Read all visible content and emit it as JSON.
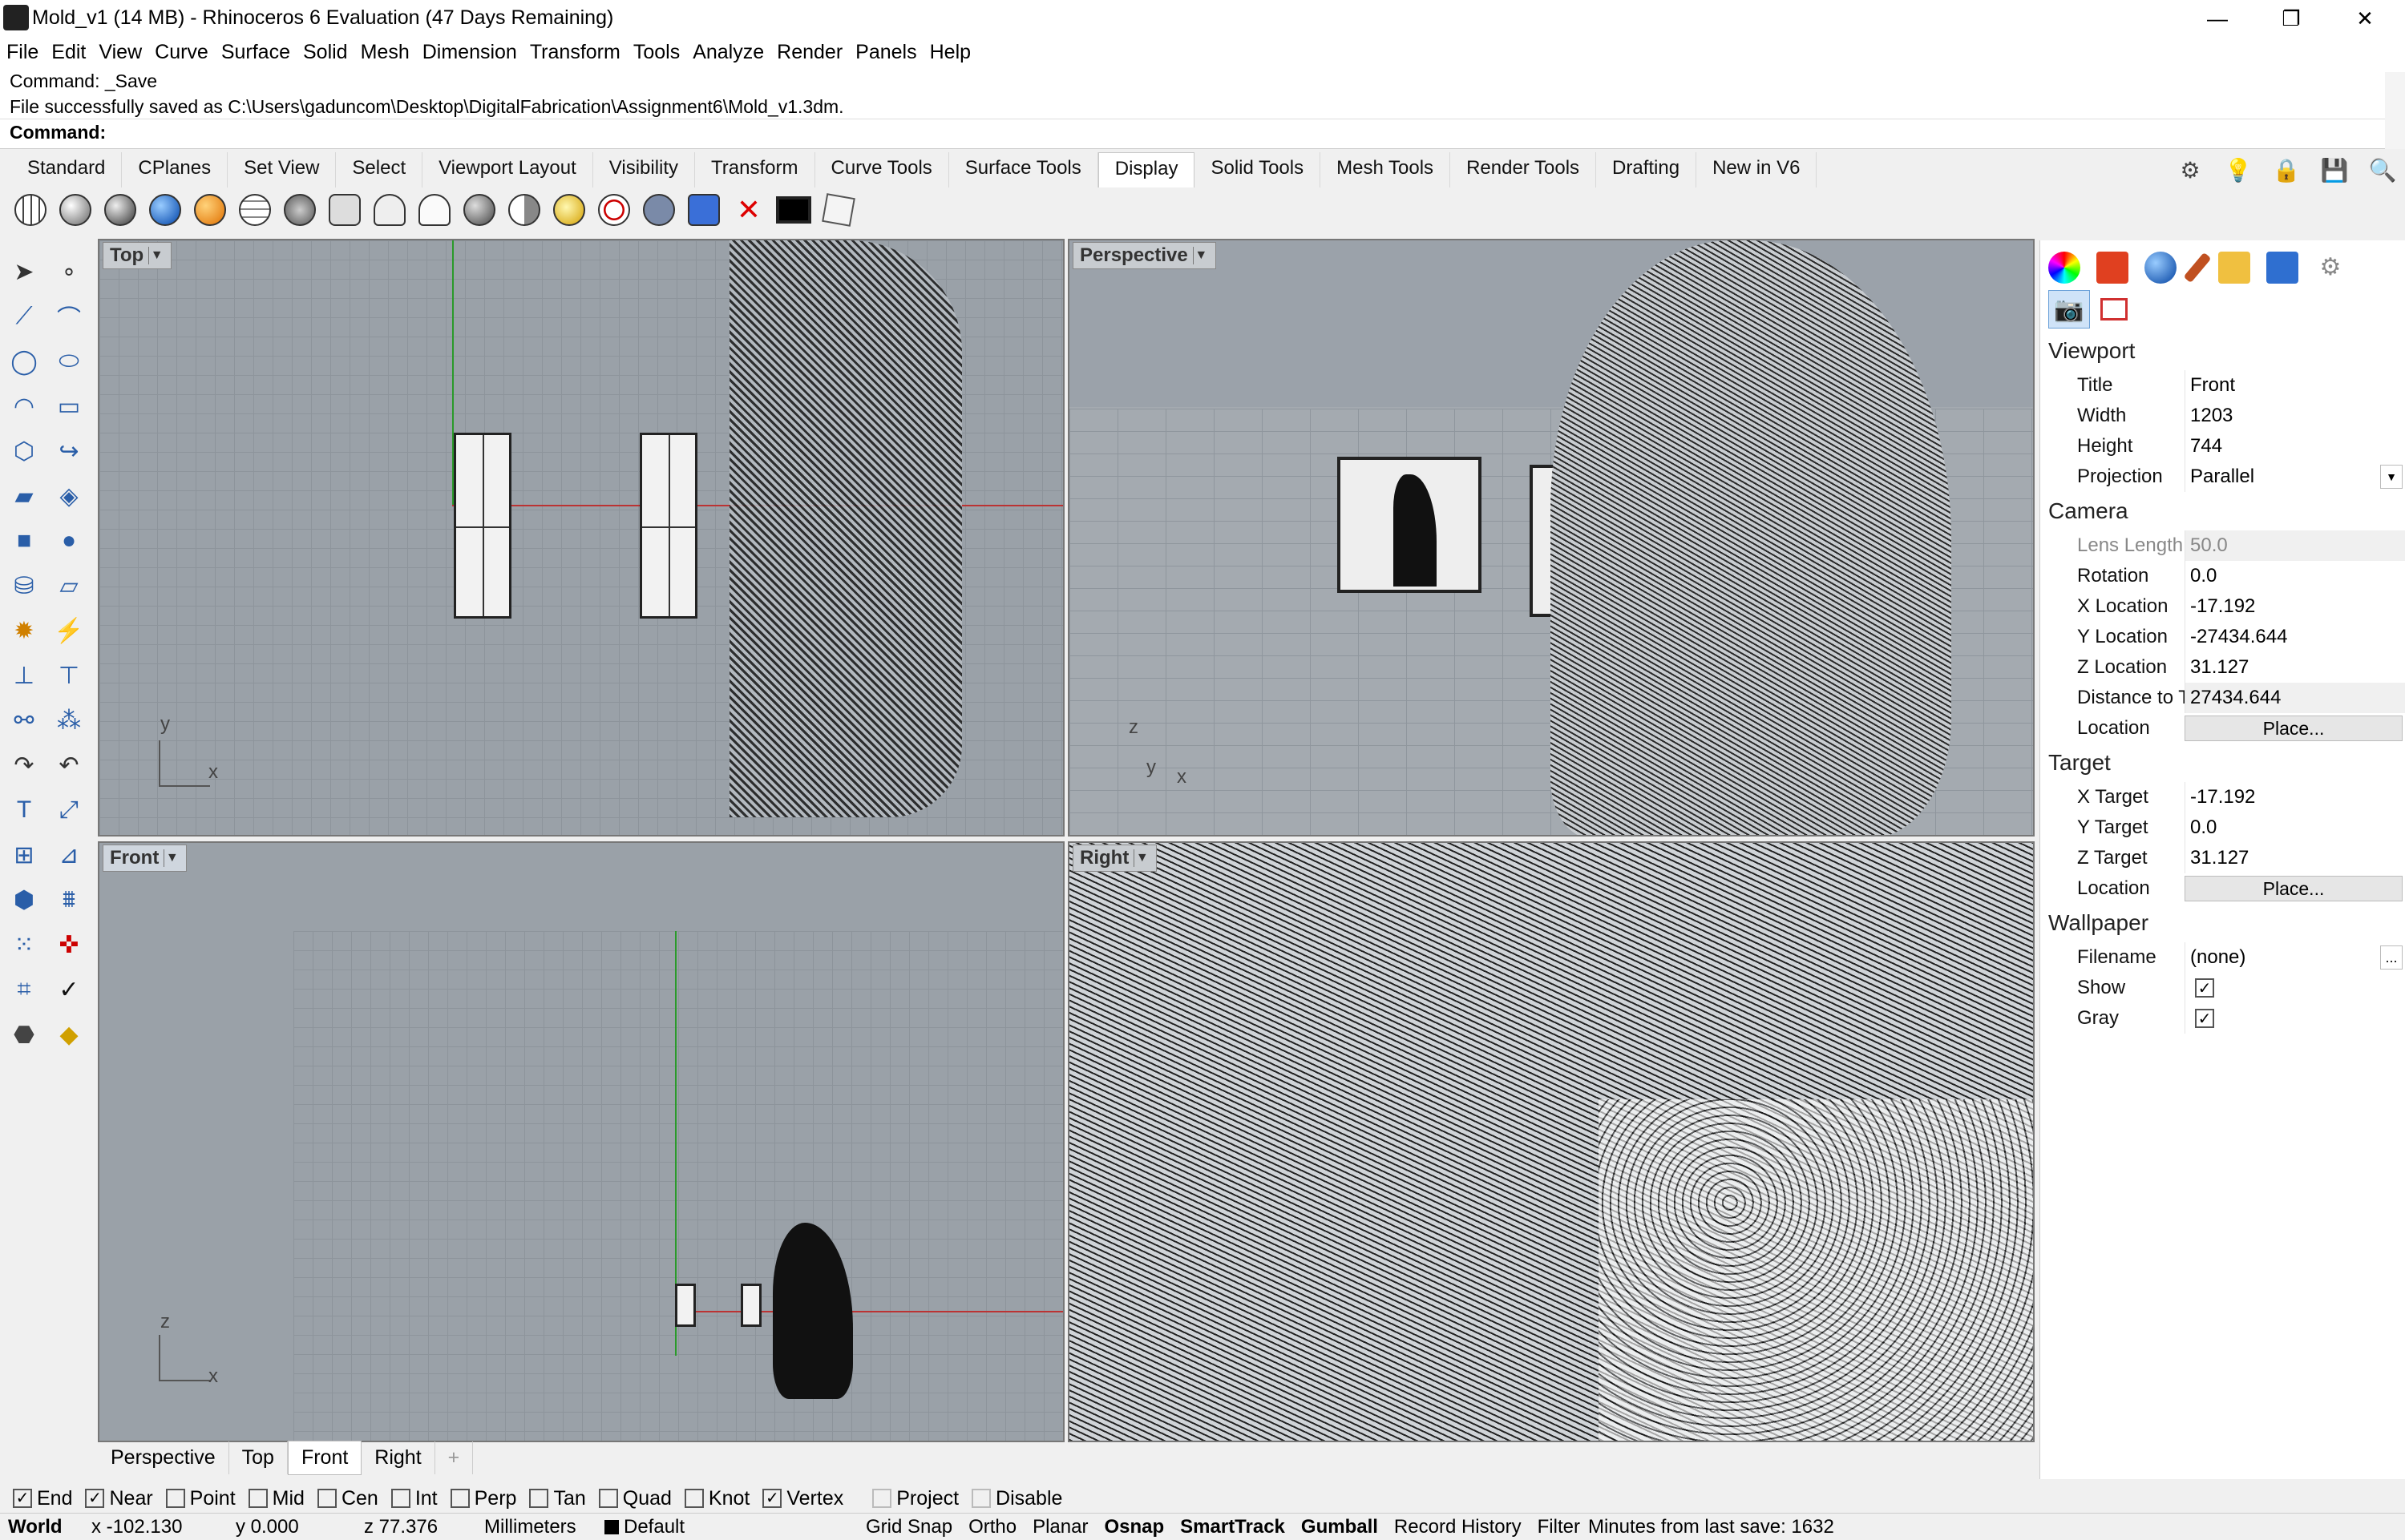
{
  "window": {
    "title": "Mold_v1 (14 MB) - Rhinoceros 6 Evaluation (47 Days Remaining)",
    "minimize": "—",
    "restore": "❐",
    "close": "✕"
  },
  "menu": [
    "File",
    "Edit",
    "View",
    "Curve",
    "Surface",
    "Solid",
    "Mesh",
    "Dimension",
    "Transform",
    "Tools",
    "Analyze",
    "Render",
    "Panels",
    "Help"
  ],
  "command": {
    "history1": "Command: _Save",
    "history2": "File successfully saved as C:\\Users\\gaduncom\\Desktop\\DigitalFabrication\\Assignment6\\Mold_v1.3dm.",
    "prompt": "Command:"
  },
  "toolbar_tabs": [
    "Standard",
    "CPlanes",
    "Set View",
    "Select",
    "Viewport Layout",
    "Visibility",
    "Transform",
    "Curve Tools",
    "Surface Tools",
    "Display",
    "Solid Tools",
    "Mesh Tools",
    "Render Tools",
    "Drafting",
    "New in V6"
  ],
  "active_tab": "Display",
  "viewports": {
    "top": {
      "label": "Top",
      "axis1": "y",
      "axis2": "x"
    },
    "perspective": {
      "label": "Perspective",
      "axis1": "z",
      "axis2": "y",
      "axis3": "x"
    },
    "front": {
      "label": "Front",
      "axis1": "z",
      "axis2": "x"
    },
    "right": {
      "label": "Right"
    }
  },
  "viewport_tabs": [
    "Perspective",
    "Top",
    "Front",
    "Right"
  ],
  "viewport_tab_add": "+",
  "panel": {
    "viewport_title": "Viewport",
    "title_label": "Title",
    "title_value": "Front",
    "width_label": "Width",
    "width_value": "1203",
    "height_label": "Height",
    "height_value": "744",
    "projection_label": "Projection",
    "projection_value": "Parallel",
    "camera_title": "Camera",
    "lens_label": "Lens Length",
    "lens_value": "50.0",
    "rotation_label": "Rotation",
    "rotation_value": "0.0",
    "xloc_label": "X Location",
    "xloc_value": "-17.192",
    "yloc_label": "Y Location",
    "yloc_value": "-27434.644",
    "zloc_label": "Z Location",
    "zloc_value": "31.127",
    "dist_label": "Distance to Tar...",
    "dist_value": "27434.644",
    "location_label": "Location",
    "place_button": "Place...",
    "target_title": "Target",
    "xt_label": "X Target",
    "xt_value": "-17.192",
    "yt_label": "Y Target",
    "yt_value": "0.0",
    "zt_label": "Z Target",
    "zt_value": "31.127",
    "tloc_label": "Location",
    "tplace_button": "Place...",
    "wallpaper_title": "Wallpaper",
    "filename_label": "Filename",
    "filename_value": "(none)",
    "filename_button": "...",
    "show_label": "Show",
    "show_checked": "✓",
    "gray_label": "Gray",
    "gray_checked": "✓"
  },
  "osnap": [
    {
      "label": "End",
      "checked": "✓"
    },
    {
      "label": "Near",
      "checked": "✓"
    },
    {
      "label": "Point",
      "checked": ""
    },
    {
      "label": "Mid",
      "checked": ""
    },
    {
      "label": "Cen",
      "checked": ""
    },
    {
      "label": "Int",
      "checked": ""
    },
    {
      "label": "Perp",
      "checked": ""
    },
    {
      "label": "Tan",
      "checked": ""
    },
    {
      "label": "Quad",
      "checked": ""
    },
    {
      "label": "Knot",
      "checked": ""
    },
    {
      "label": "Vertex",
      "checked": "✓"
    },
    {
      "label": "Project",
      "checked": ""
    },
    {
      "label": "Disable",
      "checked": ""
    }
  ],
  "status": {
    "cplane": "World",
    "x": "x -102.130",
    "y": "y 0.000",
    "z": "z 77.376",
    "units": "Millimeters",
    "layer": "Default",
    "grid_snap": "Grid Snap",
    "ortho": "Ortho",
    "planar": "Planar",
    "osnap": "Osnap",
    "smarttrack": "SmartTrack",
    "gumball": "Gumball",
    "record_history": "Record History",
    "filter": "Filter",
    "minutes": "Minutes from last save: 1632"
  }
}
